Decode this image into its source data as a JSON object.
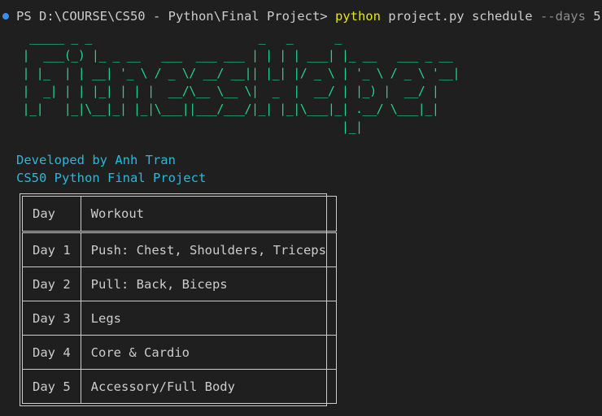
{
  "terminal": {
    "prompt": "PS D:\\COURSE\\CS50 - Python\\Final Project>",
    "command": "python",
    "args": "project.py schedule",
    "flag": "--days",
    "flag_value": "5"
  },
  "banner_lines": [
    "  _____ _ _                        _   _      _",
    " |  ___(_) |_ _ __   ___  ___ ___ | | | | ___| |_ __   ___ _ __",
    " | |_  | | __| '_ \\ / _ \\/ __/ __|| |_| |/ _ \\ | '_ \\ / _ \\ '__|",
    " |  _| | | |_| | | |  __/\\__ \\__ \\|  _  |  __/ | |_) |  __/ |",
    " |_|   |_|\\__|_| |_|\\___||___/___/|_| |_|\\___|_| .__/ \\___|_|",
    "                                               |_|"
  ],
  "credits": {
    "developer": "Developed by Anh Tran",
    "project": "CS50 Python Final Project"
  },
  "table": {
    "headers": [
      "Day",
      "Workout"
    ],
    "rows": [
      [
        "Day 1",
        "Push: Chest, Shoulders, Triceps"
      ],
      [
        "Day 2",
        "Pull: Back, Biceps"
      ],
      [
        "Day 3",
        "Legs"
      ],
      [
        "Day 4",
        "Core & Cardio"
      ],
      [
        "Day 5",
        "Accessory/Full Body"
      ]
    ]
  },
  "colors": {
    "background": "#1f1f1f",
    "banner": "#23d18b",
    "credits": "#29b8db",
    "command": "#e5e510",
    "status_dot": "#3b8eea"
  }
}
